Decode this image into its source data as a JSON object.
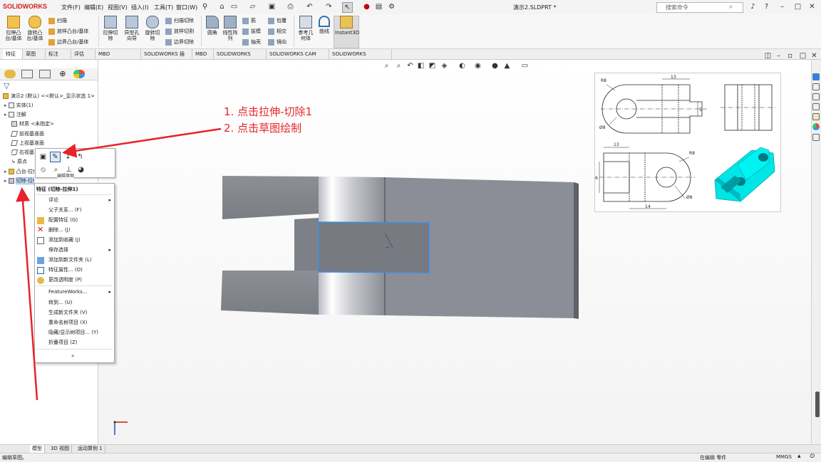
{
  "app": {
    "logo_text": "SOLIDWORKS",
    "document_title": "演示2.SLDPRT *",
    "search_placeholder": "搜索命令"
  },
  "menu": [
    {
      "label": "文件(F)"
    },
    {
      "label": "编辑(E)"
    },
    {
      "label": "视图(V)"
    },
    {
      "label": "插入(I)"
    },
    {
      "label": "工具(T)"
    },
    {
      "label": "窗口(W)"
    }
  ],
  "command_manager": {
    "big_buttons": [
      {
        "label": "拉伸凸\n台/基体"
      },
      {
        "label": "旋转凸\n台/基体"
      },
      {
        "label": "拉伸切\n除"
      },
      {
        "label": "异型孔\n向导"
      },
      {
        "label": "旋转切\n除"
      },
      {
        "label": "圆角"
      },
      {
        "label": "线性阵\n列"
      },
      {
        "label": "参考几\n何体"
      },
      {
        "label": "曲线"
      },
      {
        "label": "Instant3D"
      }
    ],
    "small_buttons": [
      {
        "label": "扫描"
      },
      {
        "label": "放样凸台/基体"
      },
      {
        "label": "边界凸台/基体"
      },
      {
        "label": "扫描切除"
      },
      {
        "label": "放样切割"
      },
      {
        "label": "边界切除"
      },
      {
        "label": "筋"
      },
      {
        "label": "拔模"
      },
      {
        "label": "抽壳"
      },
      {
        "label": "包覆"
      },
      {
        "label": "相交"
      },
      {
        "label": "镜向"
      }
    ]
  },
  "tabs": [
    {
      "label": "特征",
      "active": true
    },
    {
      "label": "草图"
    },
    {
      "label": "标注"
    },
    {
      "label": "评估"
    },
    {
      "label": "MBD Dimensions"
    },
    {
      "label": "SOLIDWORKS 插件"
    },
    {
      "label": "MBD"
    },
    {
      "label": "SOLIDWORKS CAM"
    },
    {
      "label": "SOLIDWORKS CAM TBM"
    },
    {
      "label": "SOLIDWORKS Inspection"
    }
  ],
  "feature_tree": {
    "root": "演示2 (默认) <<默认>_显示状态 1>",
    "items": [
      {
        "label": "实体(1)"
      },
      {
        "label": "注解"
      },
      {
        "label": "材质 <未指定>"
      },
      {
        "label": "前视基准面"
      },
      {
        "label": "上视基准面"
      },
      {
        "label": "右视基准面"
      },
      {
        "label": "原点"
      },
      {
        "label": "凸台-拉伸1"
      },
      {
        "label": "切除-拉伸1"
      }
    ]
  },
  "mini_toolbar": {
    "tooltip": "编辑草图"
  },
  "context_menu": {
    "title": "特征 (切除-拉伸1)",
    "items": [
      {
        "label": "评论",
        "submenu": true
      },
      {
        "label": "父子关系... (F)"
      },
      {
        "label": "配置特征 (G)"
      },
      {
        "label": "删除... (J)"
      },
      {
        "label": "添加到收藏 (J)"
      },
      {
        "label": "保存选择",
        "submenu": true
      },
      {
        "label": "添加到新文件夹 (L)"
      },
      {
        "label": "特征属性... (O)"
      },
      {
        "label": "更改透明度 (P)"
      },
      {
        "label": "FeatureWorks...",
        "submenu": true
      },
      {
        "label": "转到... (U)"
      },
      {
        "label": "生成新文件夹 (V)"
      },
      {
        "label": "重命名树项目 (X)"
      },
      {
        "label": "隐藏/显示树项目... (Y)"
      },
      {
        "label": "折叠项目 (Z)"
      },
      {
        "label": "»"
      }
    ]
  },
  "annotation": {
    "step1": "1. 点击拉伸-切除1",
    "step2": "2. 点击草图绘制"
  },
  "drawing": {
    "dims": [
      "R8",
      "13",
      "5",
      "Ø8",
      "13",
      "6",
      "R8",
      "14",
      "Ø8"
    ]
  },
  "bottom_tabs": [
    {
      "label": "模型",
      "active": true
    },
    {
      "label": "3D 视图"
    },
    {
      "label": "运动算例 1"
    }
  ],
  "status": {
    "left": "编辑草图。",
    "mode": "在编辑 零件",
    "units": "MMGS"
  },
  "colors": {
    "annotation_red": "#e8232a",
    "model_gray": "#8a8c93",
    "model_dark": "#6f7178",
    "highlight_blue": "#3b8ee8",
    "iso_cyan": "#00e5e5"
  }
}
